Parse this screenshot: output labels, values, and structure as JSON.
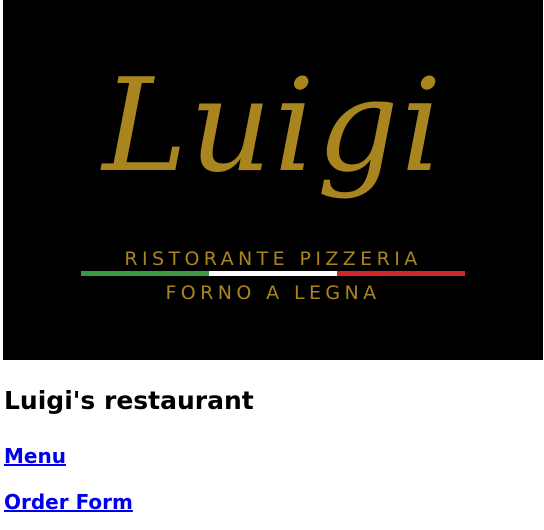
{
  "logo": {
    "script_text": "Luigi",
    "subtitle_line1": "RISTORANTE PIZZERIA",
    "subtitle_line2": "FORNO A LEGNA",
    "colors": {
      "gold": "#a9851f",
      "background": "#000000",
      "flag_green": "#3a9a3f",
      "flag_white": "#ffffff",
      "flag_red": "#d0272d"
    }
  },
  "page": {
    "title": "Luigi's restaurant"
  },
  "nav": {
    "menu_label": "Menu",
    "order_form_label": "Order Form"
  },
  "colors": {
    "link": "#0000ee",
    "text": "#000000"
  }
}
